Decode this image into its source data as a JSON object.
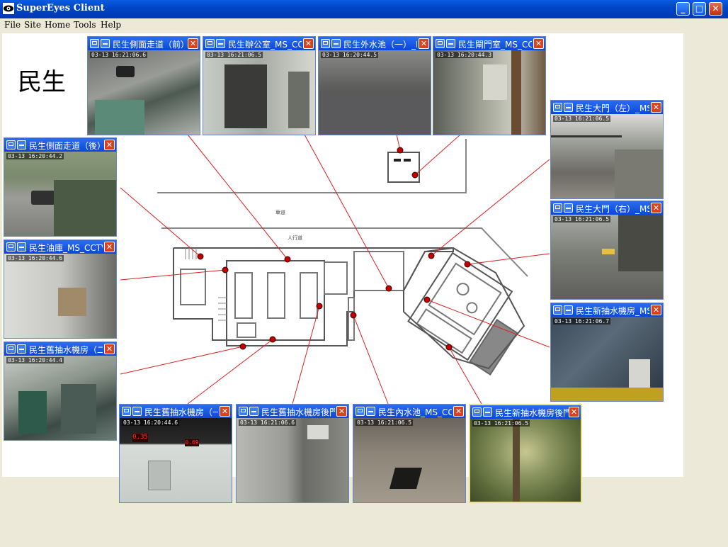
{
  "window": {
    "title": "SuperEyes Client",
    "minimize_glyph": "_",
    "maximize_glyph": "□",
    "close_glyph": "✕",
    "accent": "#0a48d8"
  },
  "menu": [
    "File",
    "Site",
    "Home",
    "Tools",
    "Help"
  ],
  "site": {
    "name": "民生"
  },
  "colors": {
    "pointer": "#e02020",
    "marker": "#c00000",
    "close_button": "#d8421c"
  },
  "cameras": [
    {
      "title": "民生側面走道（前）",
      "timestamp": "03-13 16:21:06.6",
      "scene": "walkway-street",
      "icon": "cctv-camera-icon"
    },
    {
      "title": "民生辦公室_MS_CCTV",
      "timestamp": "03-13 16:21:06.5",
      "scene": "office-door",
      "icon": "cctv-camera-icon"
    },
    {
      "title": "民生外水池（一）_MS",
      "timestamp": "03-13 16:20:44.5",
      "scene": "dark-pool",
      "icon": "cctv-camera-icon"
    },
    {
      "title": "民生閘門室_MS_CCTV",
      "timestamp": "03-13 16:20:44.3",
      "scene": "gate-room",
      "icon": "cctv-camera-icon"
    },
    {
      "title": "民生大門（左）_MS",
      "timestamp": "03-13 16:21:06.5",
      "scene": "gate-left",
      "icon": "cctv-camera-icon"
    },
    {
      "title": "民生側面走道（後）",
      "timestamp": "03-13 16:20:44.2",
      "scene": "side-road",
      "icon": "cctv-camera-icon"
    },
    {
      "title": "民生大門（右）_MS",
      "timestamp": "03-13 16:21:06.5",
      "scene": "gate-right",
      "icon": "cctv-camera-icon"
    },
    {
      "title": "民生油庫_MS_CCTV",
      "timestamp": "03-13 16:20:44.6",
      "scene": "oil-store",
      "icon": "cctv-camera-icon"
    },
    {
      "title": "民生新抽水機房_MS",
      "timestamp": "03-13 16:21:06.7",
      "scene": "pump-new",
      "icon": "cctv-camera-icon"
    },
    {
      "title": "民生舊抽水機房（二）",
      "timestamp": "03-13 16:20:44.4",
      "scene": "pump-old",
      "icon": "cctv-camera-icon"
    },
    {
      "title": "民生舊抽水機房（一）",
      "timestamp": "03-13 16:20:44.6",
      "scene": "panel-room",
      "icon": "cctv-camera-icon"
    },
    {
      "title": "民生舊抽水機房後門",
      "timestamp": "03-13 16:21:06.6",
      "scene": "back-alley",
      "icon": "cctv-camera-icon"
    },
    {
      "title": "民生內水池_MS_CCTV",
      "timestamp": "03-13 16:21:06.5",
      "scene": "inner-pool",
      "icon": "cctv-camera-icon"
    },
    {
      "title": "民生新抽水機房後門",
      "timestamp": "03-13 16:21:06.5",
      "scene": "tree",
      "icon": "cctv-camera-icon",
      "selected": true
    }
  ],
  "floorplan": {
    "road_label": "車道",
    "sidewalk_label": "人行道"
  }
}
